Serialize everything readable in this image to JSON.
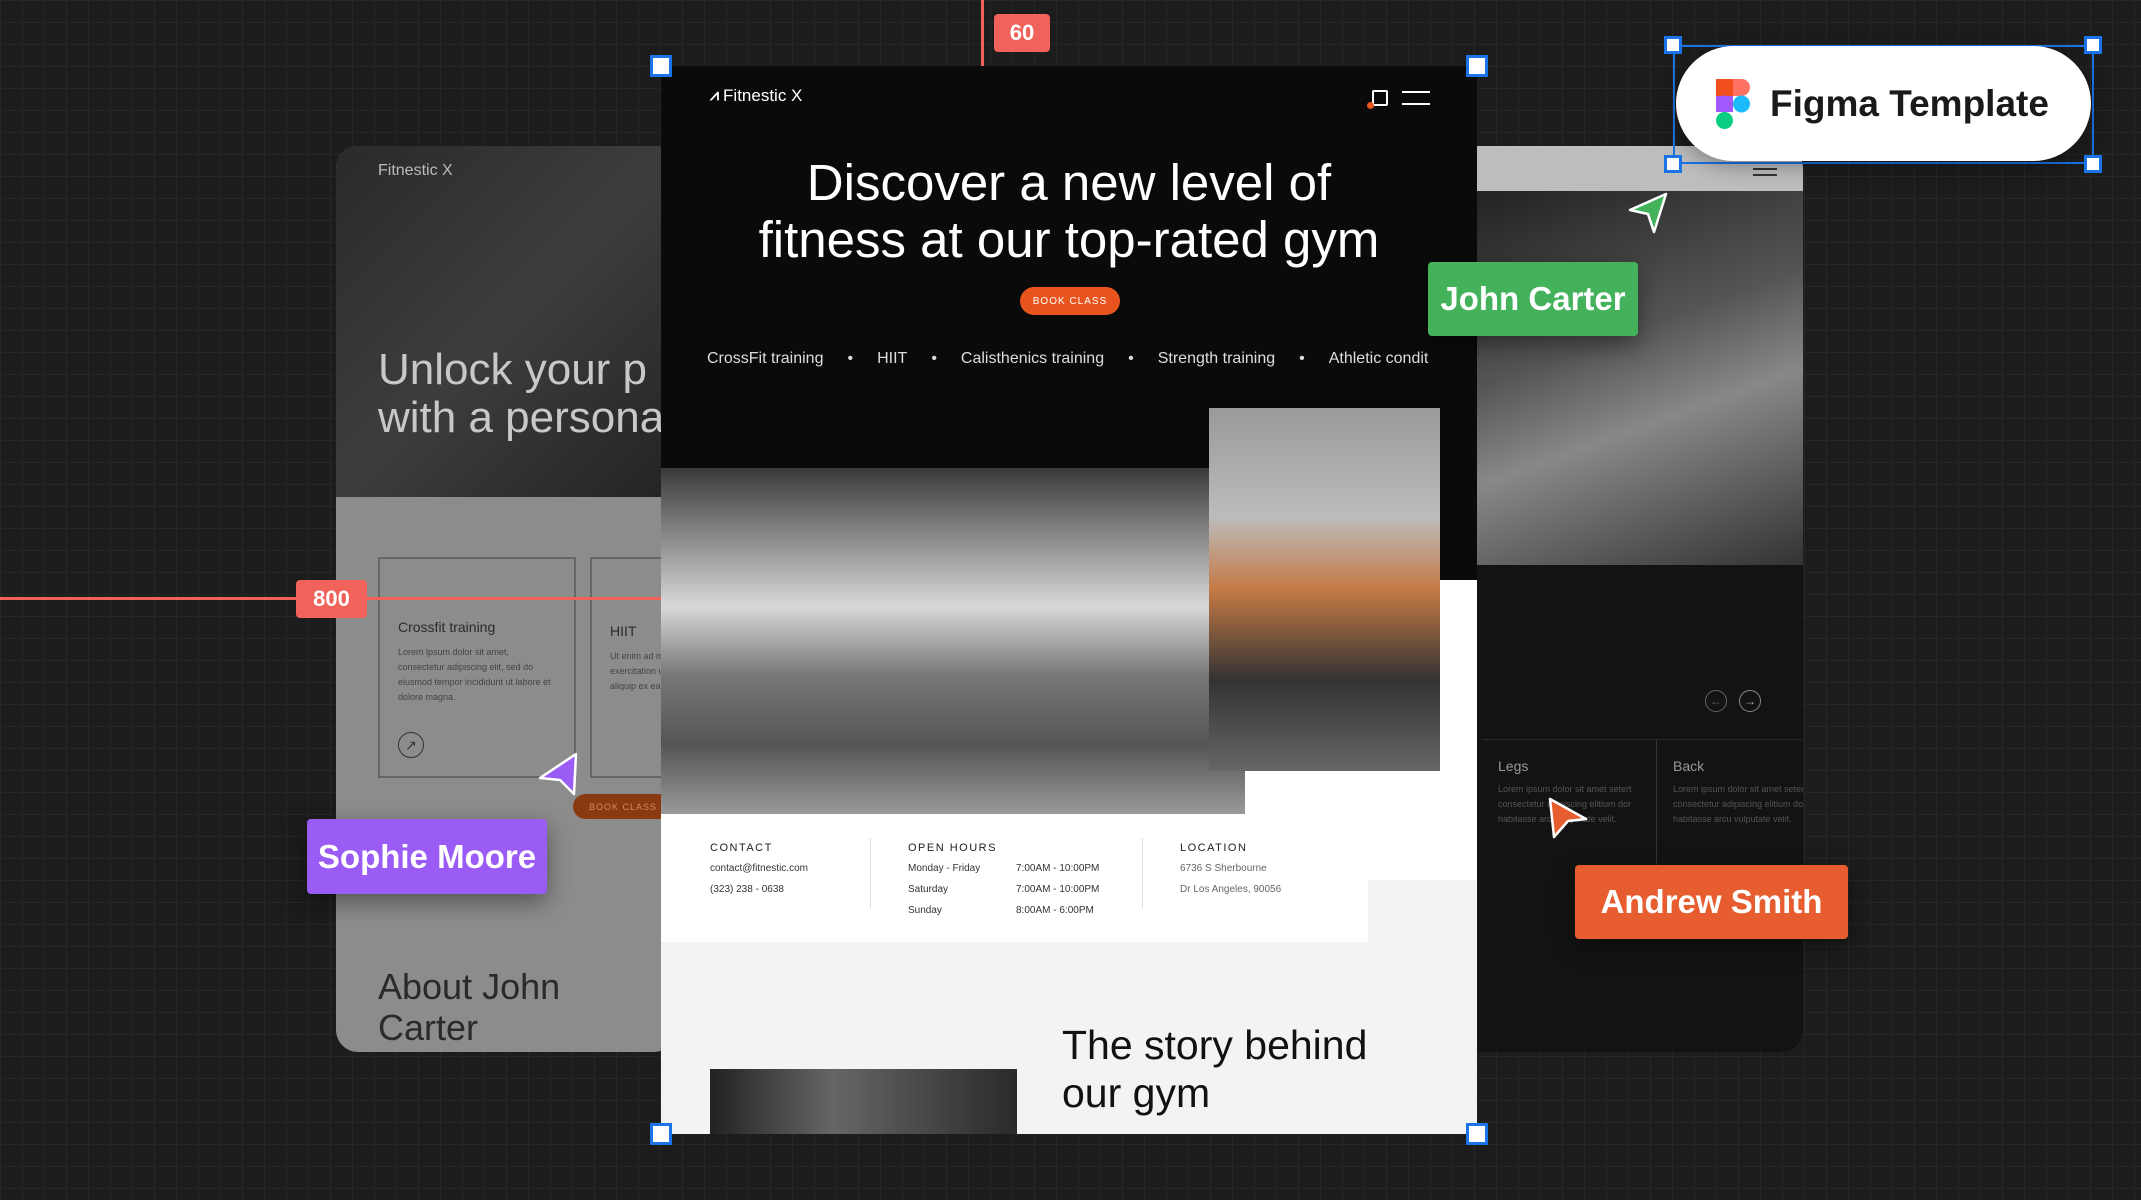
{
  "measurements": {
    "top": "60",
    "left": "800"
  },
  "figma": {
    "label": "Figma Template"
  },
  "cursors": [
    {
      "name": "John Carter",
      "color": "#43b25a"
    },
    {
      "name": "Sophie Moore",
      "color": "#9b5cf6"
    },
    {
      "name": "Andrew Smith",
      "color": "#e85d2f"
    }
  ],
  "left_page": {
    "logo": "Fitnestic X",
    "hero_line1": "Unlock your p",
    "hero_line2": "with a persona",
    "cards": [
      {
        "title": "Crossfit training",
        "text": "Lorem ipsum dolor sit amet, consectetur adipiscing elit, sed do eiusmod tempor incididunt ut labore et dolore magna."
      },
      {
        "title": "HIIT",
        "text": "Ut enim ad m exercitation u aliquip ex ea"
      }
    ],
    "book": "BOOK CLASS",
    "about": "About John Carter"
  },
  "main": {
    "logo": "Fitnestic X",
    "headline1": "Discover a new level of",
    "headline2": "fitness at our top-rated gym",
    "book": "BOOK CLASS",
    "services": [
      "CrossFit training",
      "HIIT",
      "Calisthenics training",
      "Strength training",
      "Athletic condit"
    ],
    "contact": {
      "title": "CONTACT",
      "email": "contact@fitnestic.com",
      "phone": "(323) 238 - 0638"
    },
    "hours": {
      "title": "OPEN HOURS",
      "rows": [
        [
          "Monday - Friday",
          "7:00AM - 10:00PM"
        ],
        [
          "Saturday",
          "7:00AM - 10:00PM"
        ],
        [
          "Sunday",
          "8:00AM - 6:00PM"
        ]
      ]
    },
    "location": {
      "title": "LOCATION",
      "line1": "6736 S Sherbourne",
      "line2": "Dr Los Angeles, 90056"
    },
    "story": "The story behind our gym"
  },
  "right_page": {
    "cards": [
      {
        "title": "Legs",
        "text": "Lorem ipsum dolor sit amet setert consectetur adipiscing elitium dor habitasse arcu vulputate velit."
      },
      {
        "title": "Back",
        "text": "Lorem ipsum dolor sit amet setert consectetur adipiscing elitium dor habitasse arcu vulputate velit."
      }
    ]
  }
}
